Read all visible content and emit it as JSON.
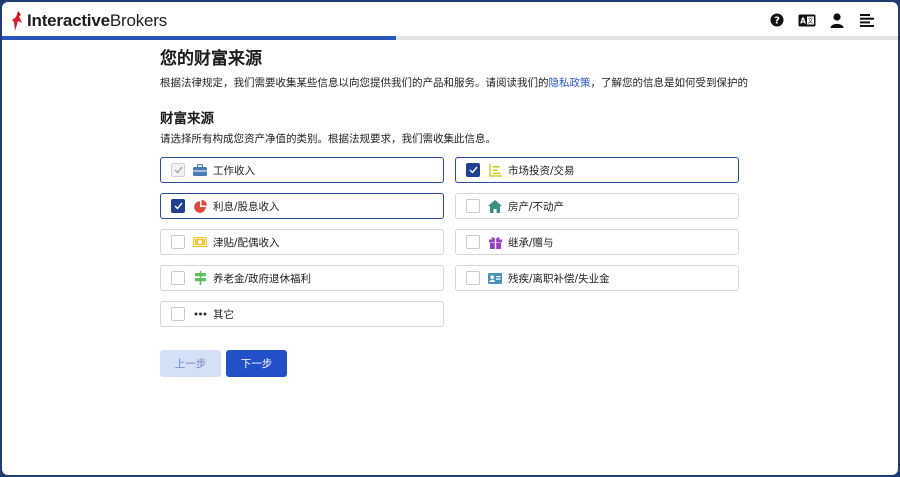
{
  "brand": {
    "bold": "Interactive",
    "regular": "Brokers"
  },
  "header": {
    "icons": [
      "help-icon",
      "language-icon",
      "user-icon",
      "menu-icon"
    ],
    "progress": 0.44
  },
  "page": {
    "title": "您的财富来源",
    "intro_before": "根据法律规定，我们需要收集某些信息以向您提供我们的产品和服务。请阅读我们的",
    "intro_link": "隐私政策",
    "intro_after": "，了解您的信息是如何受到保护的"
  },
  "section": {
    "title": "财富来源",
    "description": "请选择所有构成您资产净值的类别。根据法规要求，我们需收集此信息。"
  },
  "options": [
    {
      "label": "工作收入",
      "icon": "briefcase-icon",
      "state": "checked-disabled"
    },
    {
      "label": "市场投资/交易",
      "icon": "chart-icon",
      "state": "checked"
    },
    {
      "label": "利息/股息收入",
      "icon": "pie-chart-icon",
      "state": "checked"
    },
    {
      "label": "房产/不动产",
      "icon": "house-icon",
      "state": "unchecked"
    },
    {
      "label": "津贴/配偶收入",
      "icon": "money-icon",
      "state": "unchecked"
    },
    {
      "label": "继承/赠与",
      "icon": "gift-icon",
      "state": "unchecked"
    },
    {
      "label": "养老金/政府退休福利",
      "icon": "signpost-icon",
      "state": "unchecked"
    },
    {
      "label": "残疾/离职补偿/失业金",
      "icon": "id-card-icon",
      "state": "unchecked"
    },
    {
      "label": "其它",
      "icon": "more-icon",
      "state": "unchecked"
    }
  ],
  "buttons": {
    "prev": "上一步",
    "next": "下一步"
  },
  "colors": {
    "accent": "#2350c8",
    "frame": "#1f3d73",
    "link": "#2a57c9"
  }
}
